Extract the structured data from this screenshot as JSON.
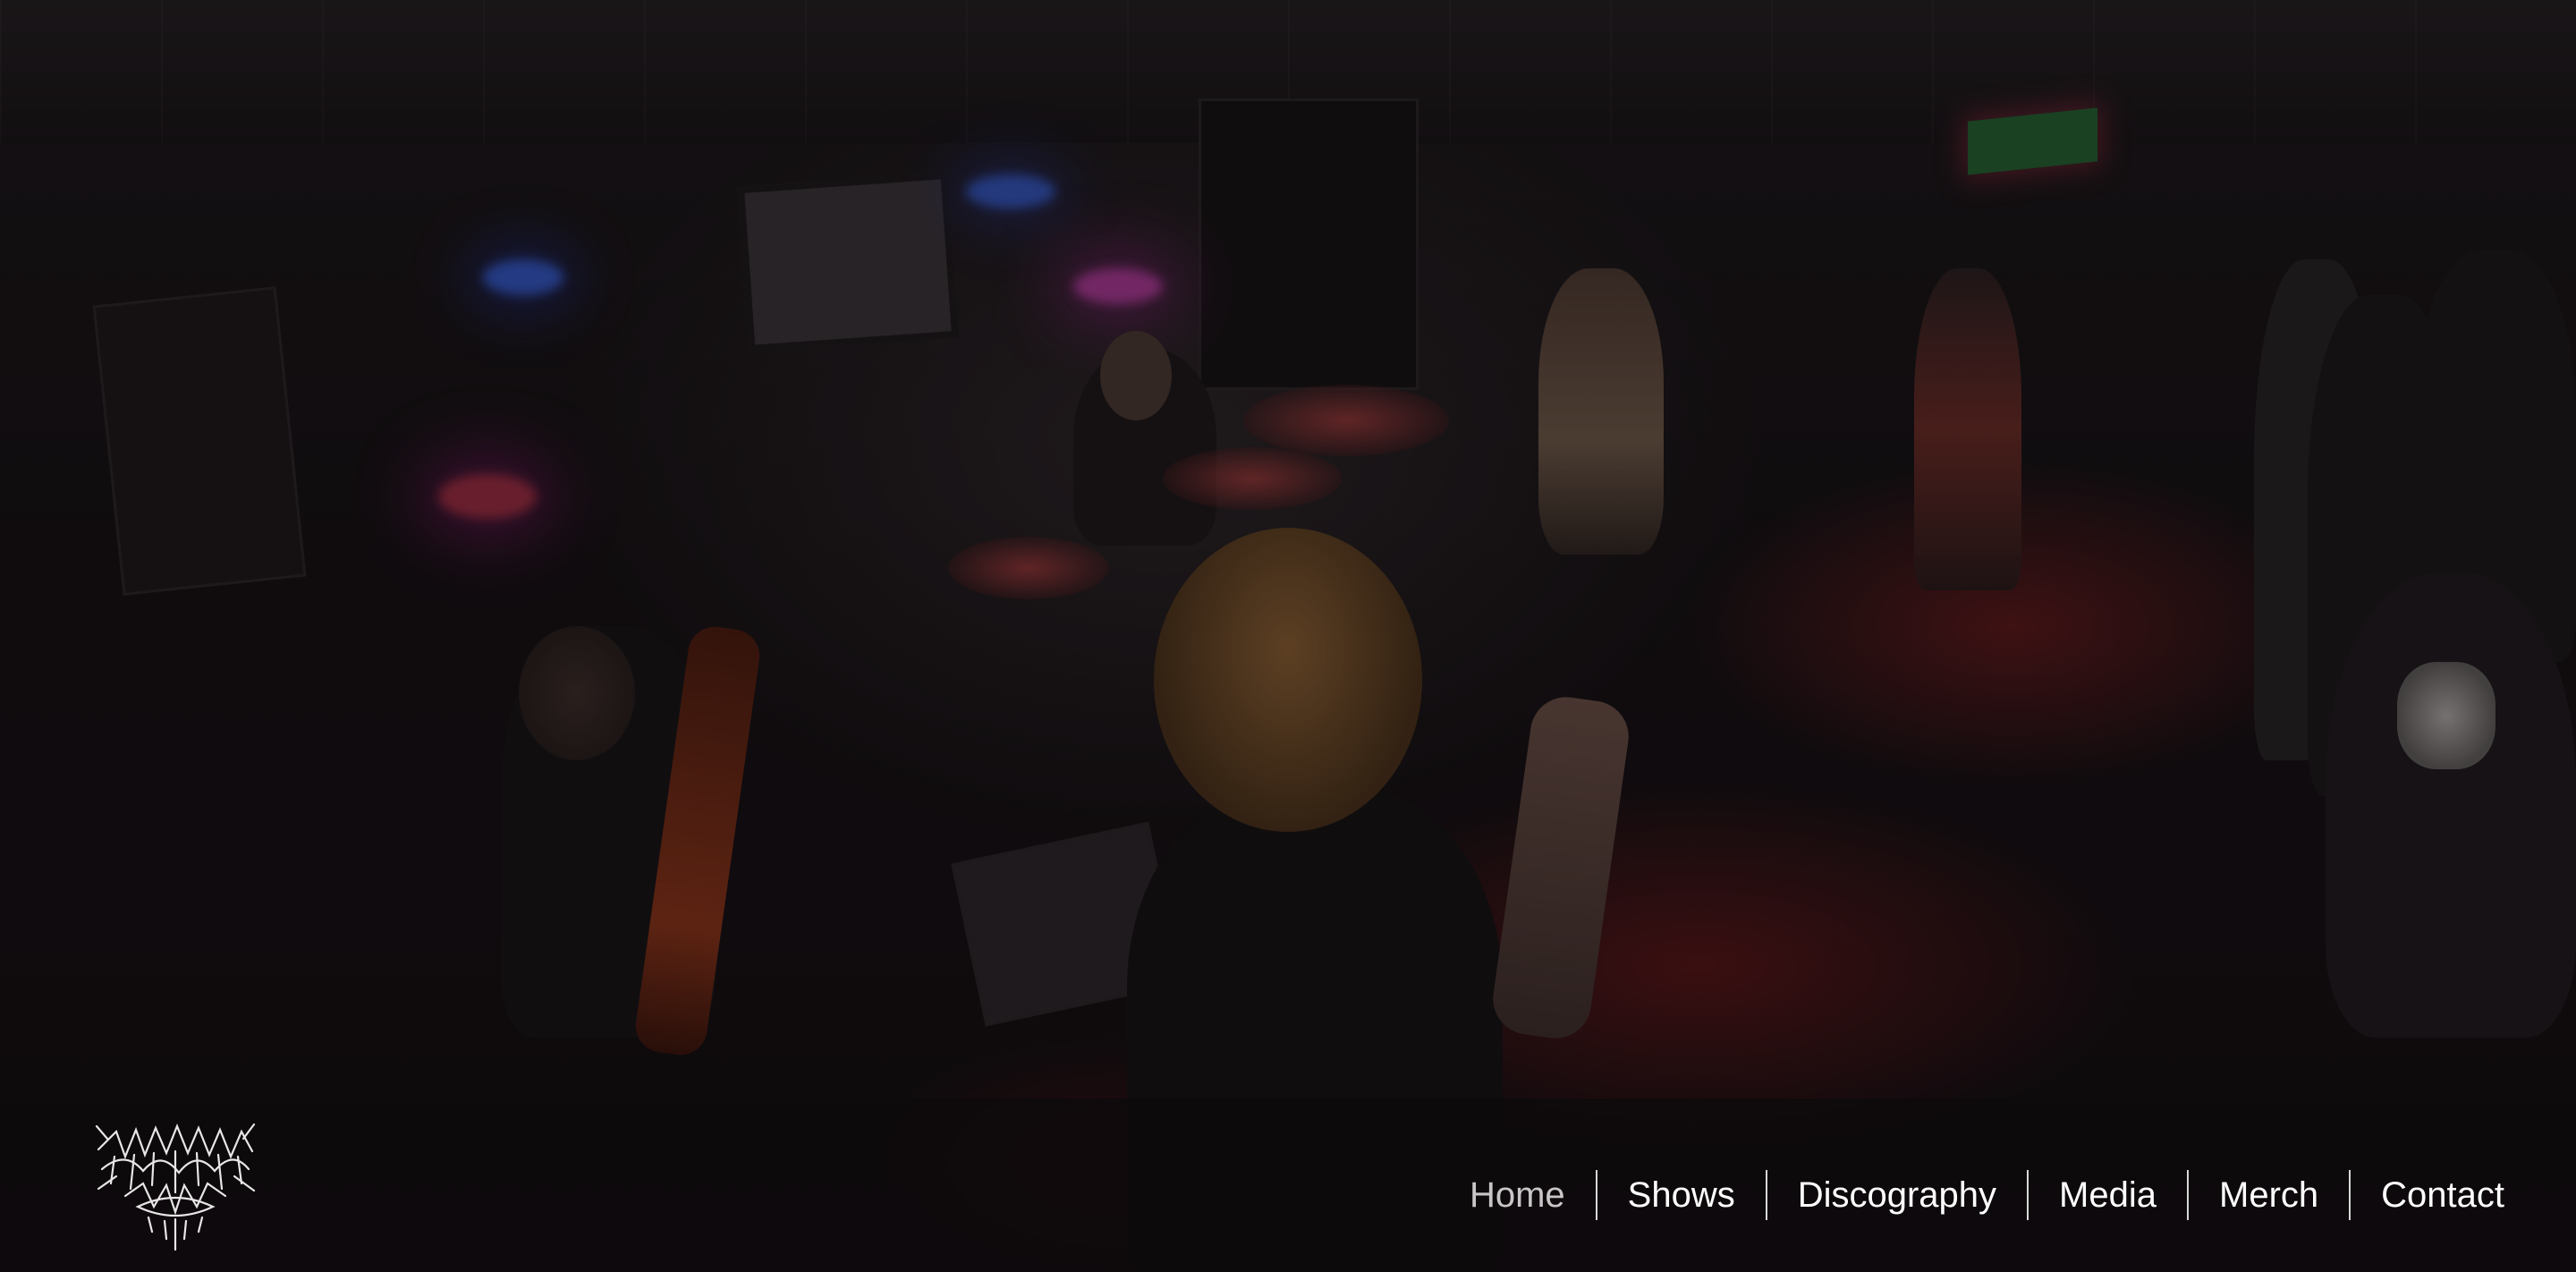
{
  "logo": {
    "alt": "band logo",
    "line1": "UNEQUIVOCAL",
    "line2": "AVERTED"
  },
  "nav": {
    "items": [
      {
        "label": "Home",
        "active": true
      },
      {
        "label": "Shows",
        "active": false
      },
      {
        "label": "Discography",
        "active": false
      },
      {
        "label": "Media",
        "active": false
      },
      {
        "label": "Merch",
        "active": false
      },
      {
        "label": "Contact",
        "active": false
      }
    ]
  },
  "colors": {
    "nav_background": "#0e0a0c",
    "nav_text": "#ffffff",
    "nav_active_text": "#c9c6c7",
    "divider": "#d8d8d8"
  }
}
